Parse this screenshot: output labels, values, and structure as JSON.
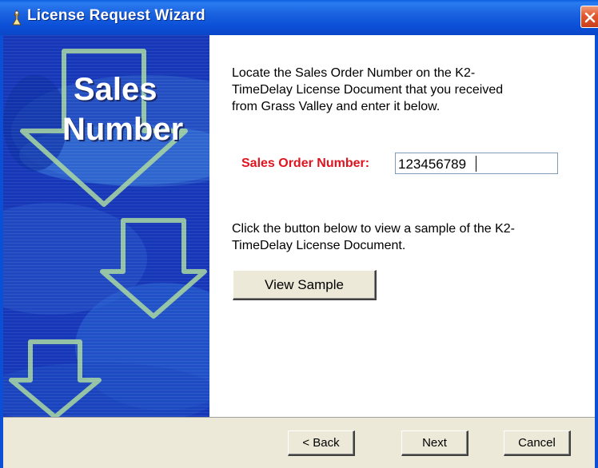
{
  "window": {
    "title": "License Request Wizard"
  },
  "banner": {
    "line1": "Sales",
    "line2": "Number"
  },
  "content": {
    "instructions": "Locate the Sales Order Number on the K2-TimeDelay License Document that you received from Grass Valley and enter it below.",
    "instructions_lines": [
      "Locate the Sales Order Number on the K2-",
      "TimeDelay License Document that you received",
      "from Grass Valley and enter it below."
    ],
    "sales_order_label": "Sales Order Number:",
    "sales_order_value": "123456789",
    "sample_text_lines": [
      "Click the button below to view a sample of the K2-",
      "TimeDelay License Document."
    ],
    "view_sample_label": "View Sample"
  },
  "footer": {
    "back_label": "< Back",
    "next_label": "Next",
    "cancel_label": "Cancel"
  },
  "colors": {
    "title_bar": "#0b4fd6",
    "label_red": "#e0141e",
    "banner_blue": "#1637b8",
    "dialog_bg": "#ece9d8"
  }
}
